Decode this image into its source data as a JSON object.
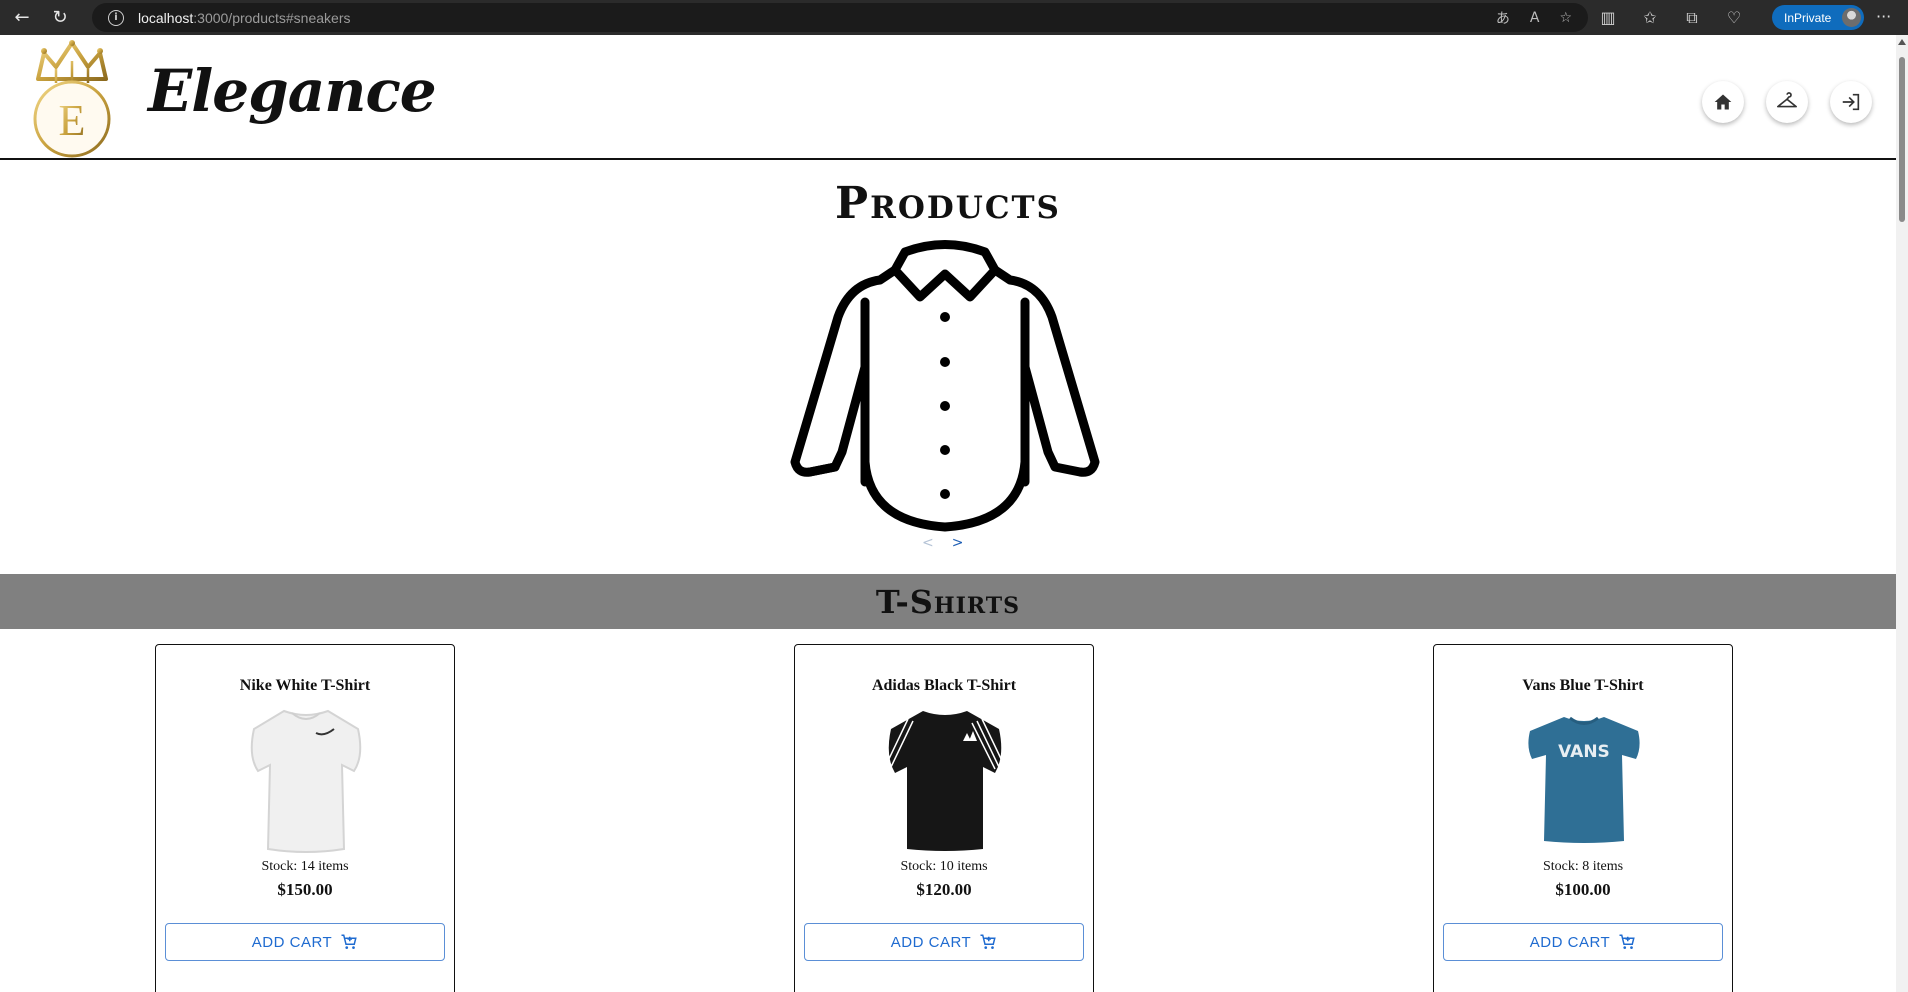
{
  "browser": {
    "url_host": "localhost",
    "url_path": ":3000/products#sneakers",
    "inprivate_label": "InPrivate"
  },
  "header": {
    "logo_letter": "E",
    "brand_name": "Elegance",
    "nav": [
      "home-icon",
      "hanger-icon",
      "login-icon"
    ]
  },
  "hero": {
    "title": "Products",
    "prev_arrow": "<",
    "next_arrow": ">"
  },
  "section": {
    "title": "T-Shirts"
  },
  "products": [
    {
      "name": "Nike White T-Shirt",
      "stock": "Stock: 14 items",
      "price": "$150.00",
      "button": "ADD CART",
      "color": "#f0f0f0",
      "logo": "✓"
    },
    {
      "name": "Adidas Black T-Shirt",
      "stock": "Stock: 10 items",
      "price": "$120.00",
      "button": "ADD CART",
      "color": "#161616",
      "logo": ""
    },
    {
      "name": "Vans Blue T-Shirt",
      "stock": "Stock: 8 items",
      "price": "$100.00",
      "button": "ADD CART",
      "color": "#2f6f95",
      "logo": "VANS"
    }
  ],
  "colors": {
    "accent": "#1f6bd0",
    "section_band": "#808080",
    "logo_gold": "#c9a23f"
  }
}
